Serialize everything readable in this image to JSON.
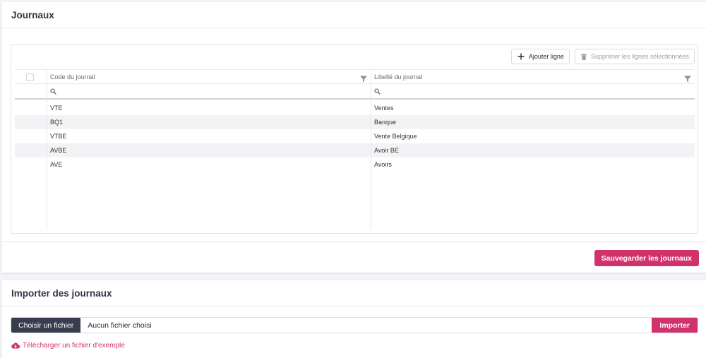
{
  "journals_card": {
    "title": "Journaux",
    "toolbar": {
      "add_label": "Ajouter ligne",
      "delete_label": "Supprimer les lignes sélectionnées"
    },
    "grid": {
      "columns": [
        "Code du journal",
        "Libellé du journal"
      ],
      "rows": [
        {
          "code": "VTE",
          "label": "Ventes"
        },
        {
          "code": "BQ1",
          "label": "Banque"
        },
        {
          "code": "VTBE",
          "label": "Vente Belgique"
        },
        {
          "code": "AVBE",
          "label": "Avoir BE"
        },
        {
          "code": "AVE",
          "label": "Avoirs"
        }
      ]
    },
    "save_label": "Sauvegarder les journaux"
  },
  "import_card": {
    "title": "Importer des journaux",
    "choose_label": "Choisir un fichier",
    "file_status": "Aucun fichier choisi",
    "import_label": "Importer",
    "download_label": "Télécharger un fichier d'exemple"
  },
  "icons": {
    "add": "plus-icon",
    "delete": "trash-icon",
    "filter": "funnel-icon",
    "search": "search-icon",
    "download": "cloud-download-icon"
  },
  "colors": {
    "accent": "#d1326b",
    "dark_button": "#363d4d",
    "row_alt": "#f3f3f5",
    "background": "#f3f4f8"
  }
}
